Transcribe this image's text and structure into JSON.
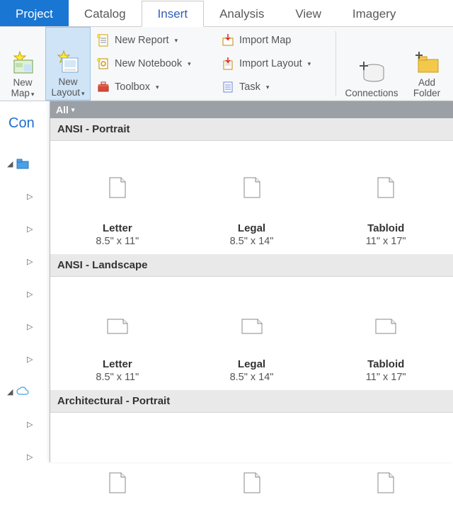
{
  "tabs": {
    "project": "Project",
    "catalog": "Catalog",
    "insert": "Insert",
    "analysis": "Analysis",
    "view": "View",
    "imagery": "Imagery"
  },
  "ribbon": {
    "new_map": "New\nMap",
    "new_layout": "New\nLayout",
    "new_report": "New Report",
    "new_notebook": "New Notebook",
    "toolbox": "Toolbox",
    "import_map": "Import Map",
    "import_layout": "Import Layout",
    "task": "Task",
    "connections": "Connections",
    "add_folder": "Add\nFolder"
  },
  "catalog_title": "Con",
  "gallery": {
    "filter": "All",
    "sections": [
      {
        "header": "ANSI - Portrait",
        "orient": "p",
        "items": [
          {
            "name": "Letter",
            "size": "8.5\" x 11\""
          },
          {
            "name": "Legal",
            "size": "8.5\" x 14\""
          },
          {
            "name": "Tabloid",
            "size": "11\" x 17\""
          }
        ]
      },
      {
        "header": "ANSI - Landscape",
        "orient": "l",
        "items": [
          {
            "name": "Letter",
            "size": "8.5\" x 11\""
          },
          {
            "name": "Legal",
            "size": "8.5\" x 14\""
          },
          {
            "name": "Tabloid",
            "size": "11\" x 17\""
          }
        ]
      },
      {
        "header": "Architectural - Portrait",
        "orient": "p",
        "items": [
          {
            "name": "",
            "size": ""
          },
          {
            "name": "",
            "size": ""
          },
          {
            "name": "",
            "size": ""
          }
        ]
      }
    ]
  }
}
